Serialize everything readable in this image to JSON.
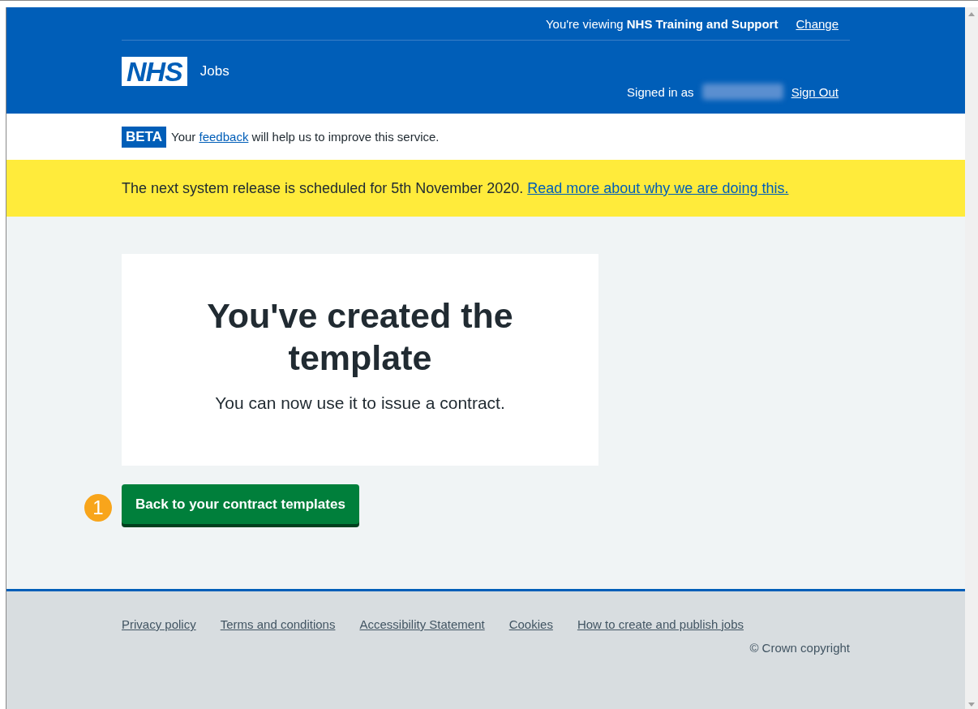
{
  "header": {
    "viewing_prefix": "You're viewing ",
    "viewing_org": "NHS Training and Support",
    "change_link": "Change",
    "logo": "NHS",
    "service_name": "Jobs",
    "signed_in_label": "Signed in as",
    "sign_out_link": "Sign Out"
  },
  "phase_banner": {
    "tag": "BETA",
    "text_before": "Your ",
    "link": "feedback",
    "text_after": " will help us to improve this service."
  },
  "notice": {
    "text": "The next system release is scheduled for 5th November 2020.",
    "link": "Read more about why we are doing this."
  },
  "panel": {
    "title": "You've created the template",
    "body": "You can now use it to issue a contract."
  },
  "callout": "1",
  "button": "Back to your contract templates",
  "footer": {
    "links": [
      "Privacy policy",
      "Terms and conditions",
      "Accessibility Statement",
      "Cookies",
      "How to create and publish jobs"
    ],
    "copyright": "© Crown copyright"
  }
}
